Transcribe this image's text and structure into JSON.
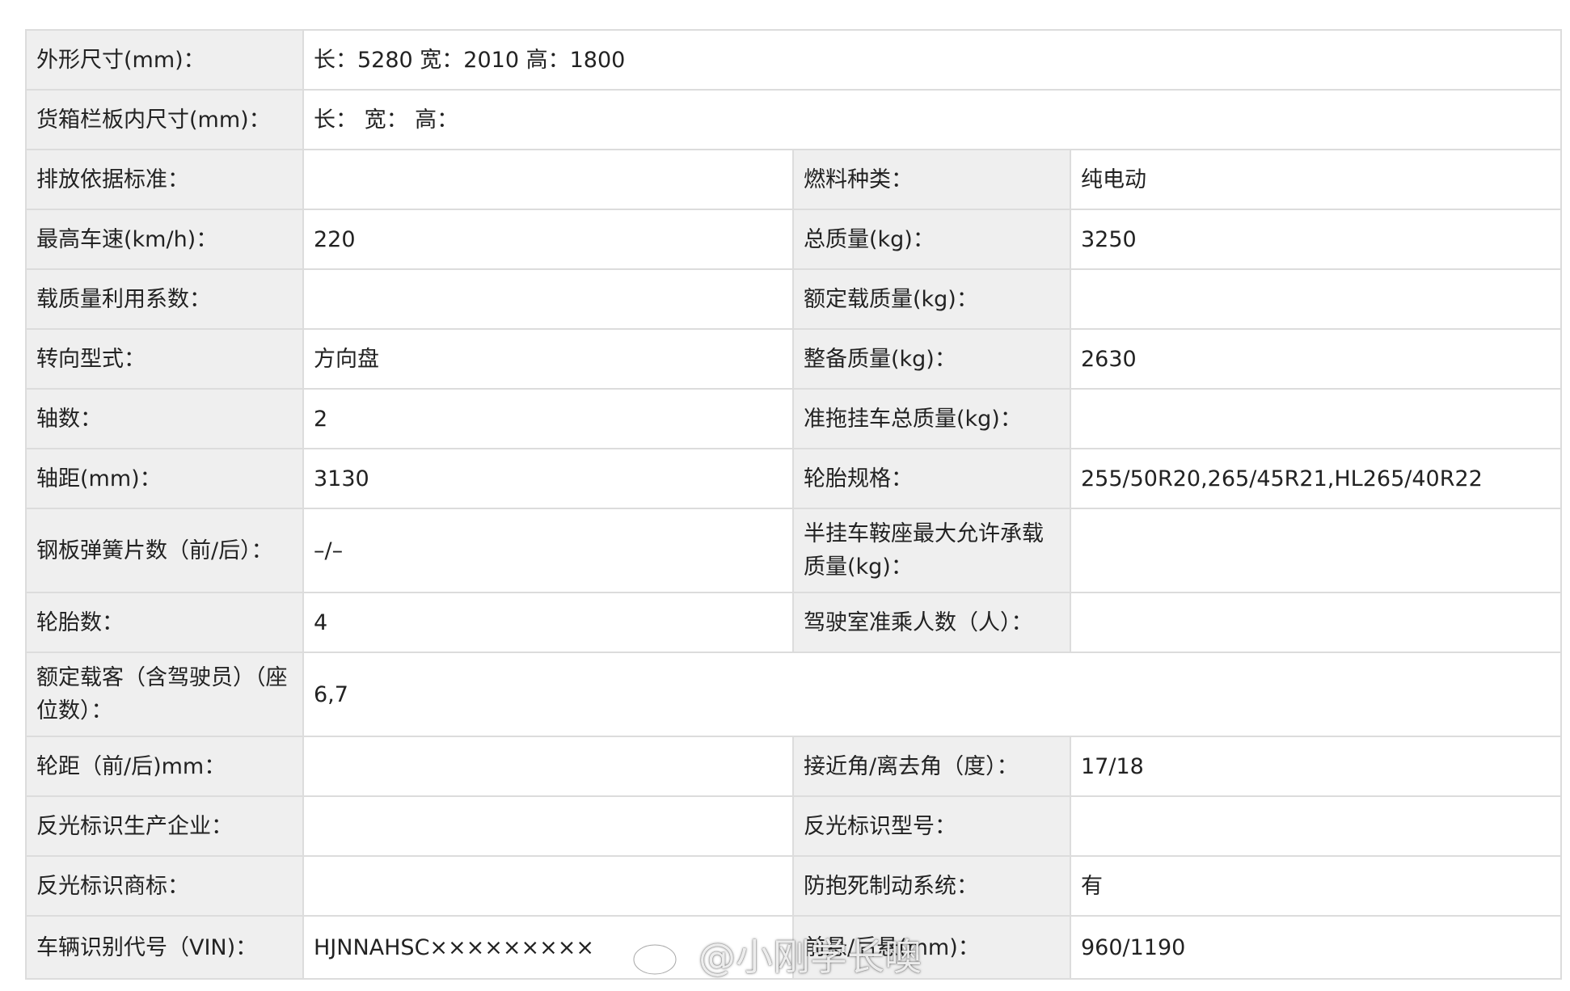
{
  "rows": [
    {
      "label": "外形尺寸(mm)：",
      "value": "长：5280 宽：2010 高：1800"
    },
    {
      "label": "货箱栏板内尺寸(mm)：",
      "value": "长：  宽：  高："
    },
    {
      "label": "排放依据标准：",
      "value": "",
      "label2": "燃料种类：",
      "value2": "纯电动"
    },
    {
      "label": "最高车速(km/h)：",
      "value": "220",
      "label2": "总质量(kg)：",
      "value2": "3250"
    },
    {
      "label": "载质量利用系数：",
      "value": "",
      "label2": "额定载质量(kg)：",
      "value2": ""
    },
    {
      "label": "转向型式：",
      "value": "方向盘",
      "label2": "整备质量(kg)：",
      "value2": "2630"
    },
    {
      "label": "轴数：",
      "value": "2",
      "label2": "准拖挂车总质量(kg)：",
      "value2": ""
    },
    {
      "label": "轴距(mm)：",
      "value": "3130",
      "label2": "轮胎规格：",
      "value2": "255/50R20,265/45R21,HL265/40R22"
    },
    {
      "label": "钢板弹簧片数（前/后）：",
      "value": "–/–",
      "label2": "半挂车鞍座最大允许承载质量(kg)：",
      "value2": ""
    },
    {
      "label": "轮胎数：",
      "value": "4",
      "label2": "驾驶室准乘人数（人）：",
      "value2": ""
    },
    {
      "label": "额定载客（含驾驶员）（座位数）：",
      "value": "6,7"
    },
    {
      "label": "轮距（前/后)mm：",
      "value": "",
      "label2": "接近角/离去角（度）：",
      "value2": "17/18"
    },
    {
      "label": "反光标识生产企业：",
      "value": "",
      "label2": "反光标识型号：",
      "value2": ""
    },
    {
      "label": "反光标识商标：",
      "value": "",
      "label2": "防抱死制动系统：",
      "value2": "有"
    },
    {
      "label": "车辆识别代号（VIN)：",
      "value": "HJNNAHSC×××××××××",
      "label2": "前悬/后悬(mm)：",
      "value2": "960/1190"
    }
  ],
  "watermark": {
    "text": "@小刚学长噢",
    "icon": "weibo-logo-icon"
  }
}
